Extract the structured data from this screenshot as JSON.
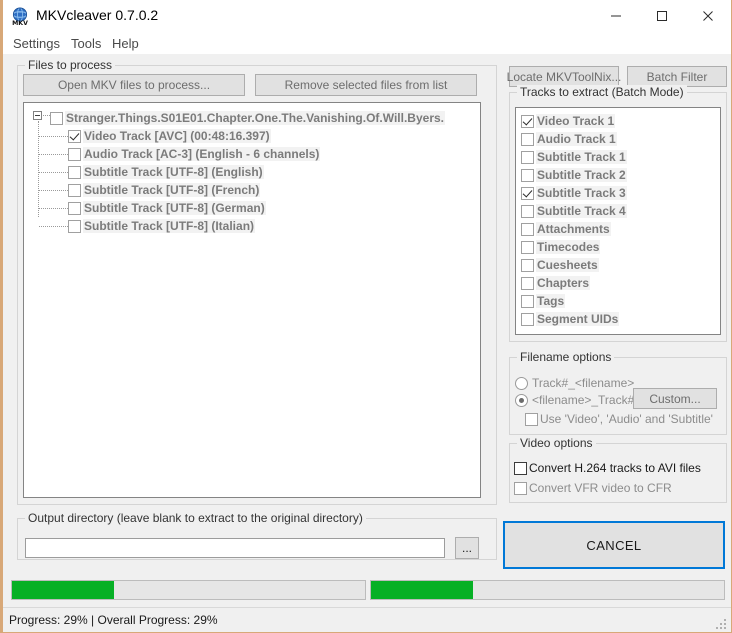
{
  "window": {
    "title": "MKVcleaver 0.7.0.2",
    "icon": "mkv-globe-icon",
    "minimize_label": "Minimize",
    "maximize_label": "Maximize",
    "close_label": "Close"
  },
  "menubar": {
    "items": [
      {
        "label": "Settings"
      },
      {
        "label": "Tools"
      },
      {
        "label": "Help"
      }
    ]
  },
  "files_panel": {
    "group_title": "Files to process",
    "open_button": "Open MKV files to process...",
    "remove_button": "Remove selected files from list",
    "tree": {
      "root": {
        "label": "Stranger.Things.S01E01.Chapter.One.The.Vanishing.Of.Will.Byers.",
        "checked": false,
        "expanded": true
      },
      "children": [
        {
          "label": "Video Track [AVC] (00:48:16.397)",
          "checked": true
        },
        {
          "label": "Audio Track [AC-3] (English - 6 channels)",
          "checked": false
        },
        {
          "label": "Subtitle Track [UTF-8] (English)",
          "checked": false
        },
        {
          "label": "Subtitle Track [UTF-8] (French)",
          "checked": false
        },
        {
          "label": "Subtitle Track [UTF-8] (German)",
          "checked": false
        },
        {
          "label": "Subtitle Track [UTF-8] (Italian)",
          "checked": false
        }
      ]
    }
  },
  "right_panel": {
    "locate_button": "Locate MKVToolNix...",
    "batch_filter_button": "Batch Filter",
    "tracks_group_title": "Tracks to extract (Batch Mode)",
    "tracks": [
      {
        "label": "Video Track 1",
        "checked": true
      },
      {
        "label": "Audio Track 1",
        "checked": false
      },
      {
        "label": "Subtitle Track 1",
        "checked": false
      },
      {
        "label": "Subtitle Track 2",
        "checked": false
      },
      {
        "label": "Subtitle Track 3",
        "checked": true
      },
      {
        "label": "Subtitle Track 4",
        "checked": false
      },
      {
        "label": "Attachments",
        "checked": false
      },
      {
        "label": "Timecodes",
        "checked": false
      },
      {
        "label": "Cuesheets",
        "checked": false
      },
      {
        "label": "Chapters",
        "checked": false
      },
      {
        "label": "Tags",
        "checked": false
      },
      {
        "label": "Segment UIDs",
        "checked": false
      }
    ]
  },
  "filename_options": {
    "group_title": "Filename options",
    "radio_track_first": "Track#_<filename>",
    "radio_name_first": "<filename>_Track#",
    "selected": "name_first",
    "custom_button": "Custom...",
    "use_prefix_label": "Use 'Video', 'Audio' and 'Subtitle'",
    "use_prefix_checked": false
  },
  "video_options": {
    "group_title": "Video options",
    "convert_h264_label": "Convert H.264 tracks to AVI files",
    "convert_h264_checked": false,
    "convert_vfr_label": "Convert VFR video to CFR",
    "convert_vfr_checked": false
  },
  "actions": {
    "cancel_button": "CANCEL"
  },
  "output_directory": {
    "group_title": "Output directory (leave blank to extract to the original directory)",
    "value": "",
    "placeholder": "",
    "browse_button": "..."
  },
  "progress": {
    "bar1_percent": 29,
    "bar2_percent": 29,
    "status_text": "Progress: 29% | Overall Progress: 29%",
    "fill_color": "#06b025"
  }
}
